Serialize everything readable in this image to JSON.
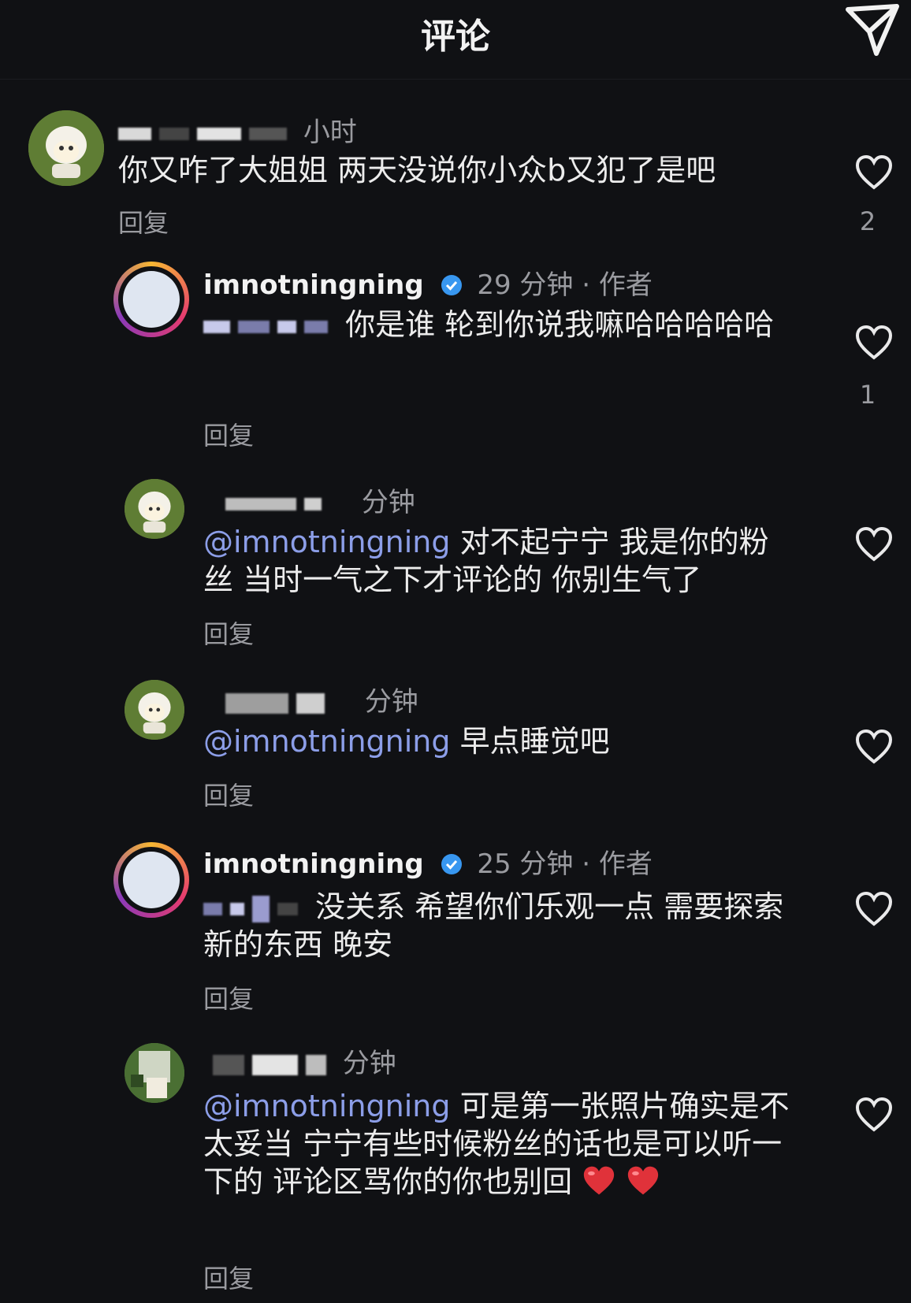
{
  "header": {
    "title": "评论"
  },
  "comments": [
    {
      "time": "小时",
      "text": "你又咋了大姐姐 两天没说你小众b又犯了是吧",
      "reply_label": "回复",
      "likes": "2"
    },
    {
      "username": "imnotningning",
      "time": "29 分钟",
      "author_tag": "· 作者",
      "text": "你是谁 轮到你说我嘛哈哈哈哈哈",
      "reply_label": "回复",
      "likes": "1"
    },
    {
      "time": "分钟",
      "mention": "@imnotningning",
      "text": " 对不起宁宁 我是你的粉丝 当时一气之下才评论的 你别生气了",
      "reply_label": "回复"
    },
    {
      "time": "分钟",
      "mention": "@imnotningning",
      "text": " 早点睡觉吧",
      "reply_label": "回复"
    },
    {
      "username": "imnotningning",
      "time": "25 分钟",
      "author_tag": "· 作者",
      "text": "没关系 希望你们乐观一点 需要探索新的东西 晚安",
      "reply_label": "回复"
    },
    {
      "time": "分钟",
      "mention": "@imnotningning",
      "text": " 可是第一张照片确实是不太妥当 宁宁有些时候粉丝的话也是可以听一下的 评论区骂你的你也别回",
      "reply_label": "回复"
    }
  ],
  "colors": {
    "background": "#101114",
    "mention": "#8c9ee8",
    "verified": "#3897f0",
    "heart_emoji": "#e0323a"
  },
  "icons": {
    "send": "paper-plane-icon",
    "like": "heart-outline-icon",
    "verified": "verified-badge-icon"
  }
}
